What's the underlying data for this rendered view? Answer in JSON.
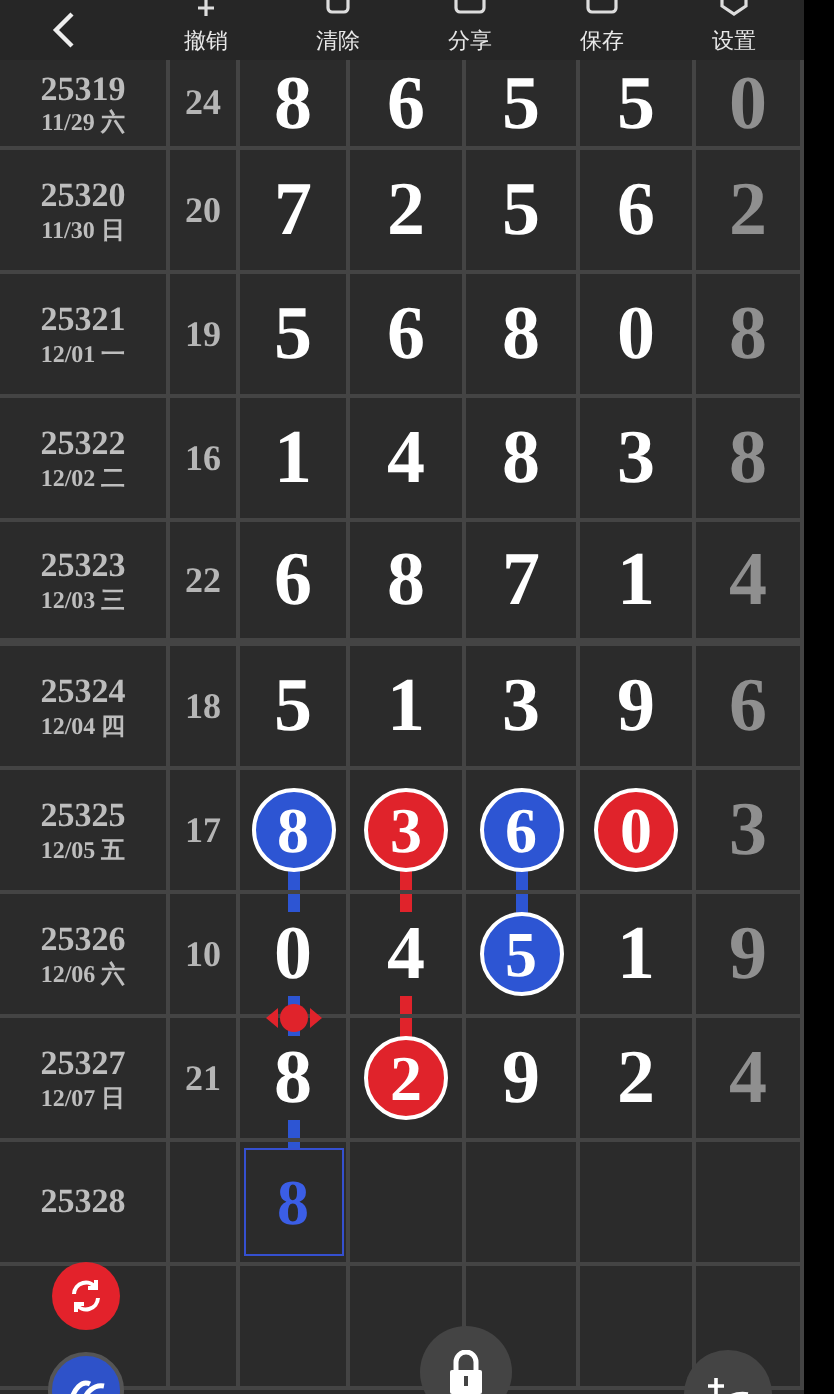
{
  "toolbar": {
    "actions": [
      {
        "label": "撤销"
      },
      {
        "label": "清除"
      },
      {
        "label": "分享"
      },
      {
        "label": "保存"
      },
      {
        "label": "设置"
      }
    ]
  },
  "rows": [
    {
      "period": "25319",
      "date": "11/29 六",
      "sum": "24",
      "digits": [
        {
          "kind": "plain",
          "value": "8"
        },
        {
          "kind": "plain",
          "value": "6"
        },
        {
          "kind": "plain",
          "value": "5"
        },
        {
          "kind": "plain",
          "value": "5"
        }
      ],
      "extra": "0"
    },
    {
      "period": "25320",
      "date": "11/30 日",
      "sum": "20",
      "digits": [
        {
          "kind": "plain",
          "value": "7"
        },
        {
          "kind": "plain",
          "value": "2"
        },
        {
          "kind": "plain",
          "value": "5"
        },
        {
          "kind": "plain",
          "value": "6"
        }
      ],
      "extra": "2"
    },
    {
      "period": "25321",
      "date": "12/01 一",
      "sum": "19",
      "digits": [
        {
          "kind": "plain",
          "value": "5"
        },
        {
          "kind": "plain",
          "value": "6"
        },
        {
          "kind": "plain",
          "value": "8"
        },
        {
          "kind": "plain",
          "value": "0"
        }
      ],
      "extra": "8"
    },
    {
      "period": "25322",
      "date": "12/02 二",
      "sum": "16",
      "digits": [
        {
          "kind": "plain",
          "value": "1"
        },
        {
          "kind": "plain",
          "value": "4"
        },
        {
          "kind": "plain",
          "value": "8"
        },
        {
          "kind": "plain",
          "value": "3"
        }
      ],
      "extra": "8"
    },
    {
      "period": "25323",
      "date": "12/03 三",
      "sum": "22",
      "digits": [
        {
          "kind": "plain",
          "value": "6"
        },
        {
          "kind": "plain",
          "value": "8"
        },
        {
          "kind": "plain",
          "value": "7"
        },
        {
          "kind": "plain",
          "value": "1"
        }
      ],
      "extra": "4"
    },
    {
      "period": "25324",
      "date": "12/04 四",
      "sum": "18",
      "digits": [
        {
          "kind": "plain",
          "value": "5"
        },
        {
          "kind": "plain",
          "value": "1"
        },
        {
          "kind": "plain",
          "value": "3"
        },
        {
          "kind": "plain",
          "value": "9"
        }
      ],
      "extra": "6"
    },
    {
      "period": "25325",
      "date": "12/05 五",
      "sum": "17",
      "digits": [
        {
          "kind": "blue",
          "value": "8"
        },
        {
          "kind": "red",
          "value": "3"
        },
        {
          "kind": "blue",
          "value": "6"
        },
        {
          "kind": "red",
          "value": "0"
        }
      ],
      "extra": "3"
    },
    {
      "period": "25326",
      "date": "12/06 六",
      "sum": "10",
      "digits": [
        {
          "kind": "plain",
          "value": "0"
        },
        {
          "kind": "plain",
          "value": "4"
        },
        {
          "kind": "blue",
          "value": "5"
        },
        {
          "kind": "plain",
          "value": "1"
        }
      ],
      "extra": "9"
    },
    {
      "period": "25327",
      "date": "12/07 日",
      "sum": "21",
      "digits": [
        {
          "kind": "marker",
          "value": "8"
        },
        {
          "kind": "red",
          "value": "2"
        },
        {
          "kind": "plain",
          "value": "9"
        },
        {
          "kind": "plain",
          "value": "2"
        }
      ],
      "extra": "4"
    },
    {
      "period": "25328",
      "digits": [
        {
          "kind": "prediction",
          "value": "8"
        },
        {
          "kind": "empty"
        },
        {
          "kind": "empty"
        },
        {
          "kind": "empty"
        }
      ]
    }
  ]
}
